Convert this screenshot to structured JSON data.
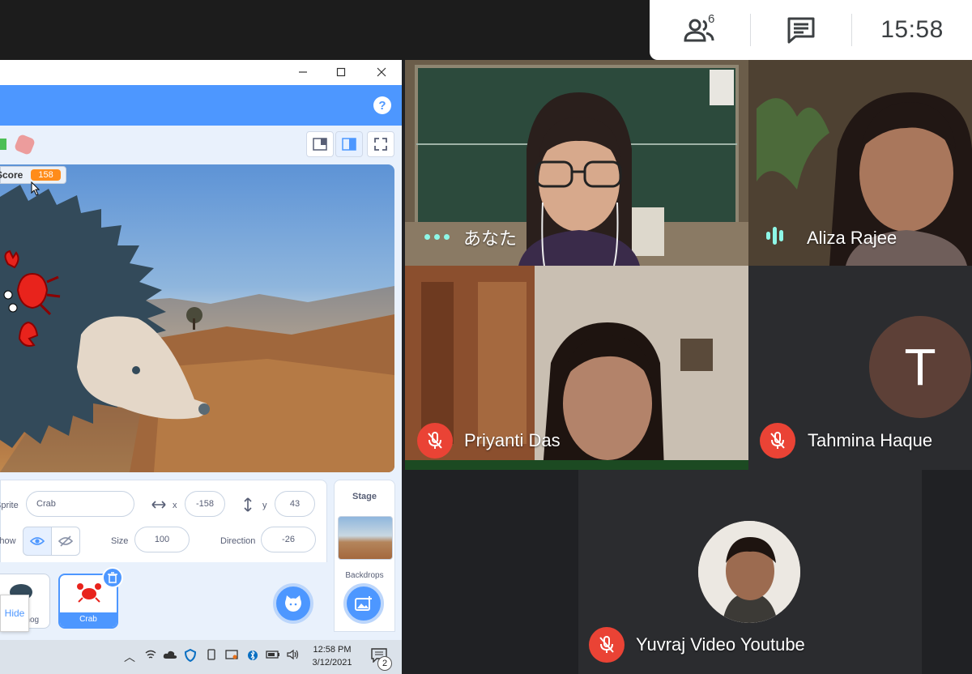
{
  "meet": {
    "participant_count": "6",
    "clock": "15:58"
  },
  "scratch": {
    "help": "?",
    "score_label": "Score",
    "score_value": "158",
    "sprite_label": "Sprite",
    "sprite_name": "Crab",
    "x_label": "x",
    "x_value": "-158",
    "y_label": "y",
    "y_value": "43",
    "show_label": "Show",
    "size_label": "Size",
    "size_value": "100",
    "direction_label": "Direction",
    "direction_value": "-26",
    "stage_label": "Stage",
    "backdrops_label": "Backdrops",
    "sprites": [
      {
        "name": "Hedgehog"
      },
      {
        "name": "Crab"
      }
    ],
    "hide_tooltip": "Hide"
  },
  "taskbar": {
    "time": "12:58 PM",
    "date": "3/12/2021",
    "notifications": "2"
  },
  "participants": [
    {
      "name": "あなた",
      "status": "speaking"
    },
    {
      "name": "Aliza Rajee",
      "status": "speaking"
    },
    {
      "name": "Priyanti Das",
      "status": "muted"
    },
    {
      "name": "Tahmina Haque",
      "status": "muted",
      "avatar_letter": "T"
    },
    {
      "name": "Yuvraj Video Youtube",
      "status": "muted"
    }
  ],
  "colors": {
    "scratch_blue": "#4d97ff",
    "meet_bg": "#202124",
    "mute_red": "#ea4335",
    "speaking_teal": "#8ef7e7",
    "score_orange": "#ff8c1a"
  }
}
